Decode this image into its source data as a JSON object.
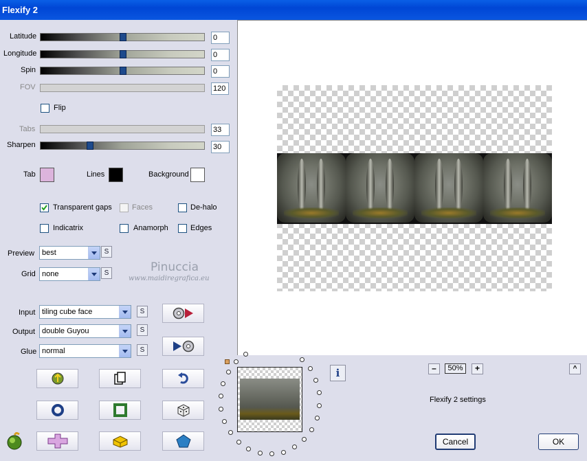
{
  "window": {
    "title": "Flexify 2"
  },
  "sliders": [
    {
      "label": "Latitude",
      "value": "0",
      "level": 0.5,
      "enabled": true
    },
    {
      "label": "Longitude",
      "value": "0",
      "level": 0.5,
      "enabled": true
    },
    {
      "label": "Spin",
      "value": "0",
      "level": 0.5,
      "enabled": true
    },
    {
      "label": "FOV",
      "value": "120",
      "enabled": false
    },
    {
      "label": "Tabs",
      "value": "33",
      "enabled": false
    },
    {
      "label": "Sharpen",
      "value": "30",
      "level": 0.3,
      "enabled": true
    }
  ],
  "flip": {
    "label": "Flip",
    "checked": false
  },
  "colors": {
    "tab": {
      "label": "Tab",
      "color": "#dcb4dc"
    },
    "lines": {
      "label": "Lines",
      "color": "#000000"
    },
    "background": {
      "label": "Background",
      "color": "#ffffff"
    }
  },
  "options": {
    "transparent_gaps": {
      "label": "Transparent gaps",
      "checked": true
    },
    "faces": {
      "label": "Faces",
      "checked": false,
      "enabled": false
    },
    "de_halo": {
      "label": "De-halo",
      "checked": false
    },
    "indicatrix": {
      "label": "Indicatrix",
      "checked": false
    },
    "anamorph": {
      "label": "Anamorph",
      "checked": false
    },
    "edges": {
      "label": "Edges",
      "checked": false
    }
  },
  "preview_select": {
    "label": "Preview",
    "value": "best",
    "s_label": "S"
  },
  "grid_select": {
    "label": "Grid",
    "value": "none",
    "s_label": "S"
  },
  "watermark": {
    "name": "Pinuccia",
    "url": "www.maidiregrafica.eu"
  },
  "input_select": {
    "label": "Input",
    "value": "tiling cube face",
    "s_label": "S"
  },
  "output_select": {
    "label": "Output",
    "value": "double Guyou",
    "s_label": "S"
  },
  "glue_select": {
    "label": "Glue",
    "value": "normal",
    "s_label": "S"
  },
  "zoom": {
    "minus": "–",
    "value": "50%",
    "plus": "+"
  },
  "status": {
    "text": "Flexify 2 settings"
  },
  "buttons": {
    "cancel": "Cancel",
    "ok": "OK",
    "info": "i",
    "collapse": "^"
  },
  "icons": [
    "load-preset-icon",
    "copy-icon",
    "undo-icon",
    "ring-icon",
    "square-icon",
    "dice-icon",
    "plugin-logo-icon",
    "add-icon",
    "brick-icon",
    "pentagon-icon",
    "play-to-disc-icon",
    "disc-to-play-icon"
  ]
}
